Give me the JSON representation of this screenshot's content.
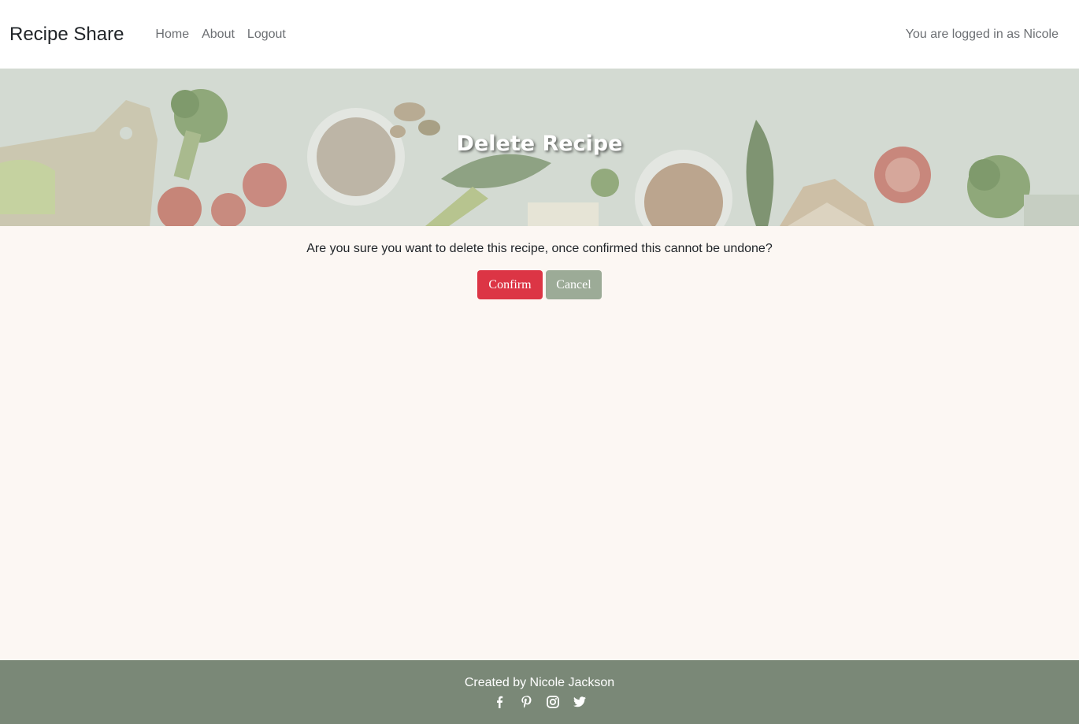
{
  "navbar": {
    "brand": "Recipe Share",
    "links": [
      "Home",
      "About",
      "Logout"
    ],
    "user_status": "You are logged in as Nicole"
  },
  "hero": {
    "title": "Delete Recipe"
  },
  "main": {
    "message": "Are you sure you want to delete this recipe, once confirmed this cannot be undone?",
    "confirm_label": "Confirm",
    "cancel_label": "Cancel"
  },
  "footer": {
    "credit": "Created by Nicole Jackson",
    "social_icons": [
      "facebook-icon",
      "pinterest-icon",
      "instagram-icon",
      "twitter-icon"
    ]
  },
  "colors": {
    "confirm": "#dc3545",
    "cancel": "#9cab97",
    "footer": "#7a8877",
    "background": "#fcf7f3"
  }
}
